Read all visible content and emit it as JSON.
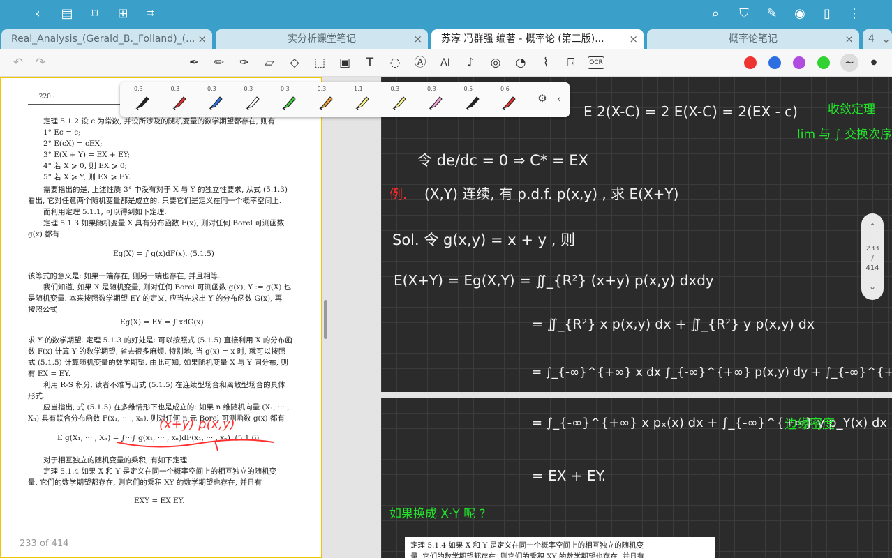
{
  "tabs": [
    {
      "label": "Real_Analysis_(Gerald_B._Folland)_(...",
      "close": "×"
    },
    {
      "label": "实分析课堂笔记",
      "close": "×"
    },
    {
      "label": "苏淳 冯群强 编著 - 概率论 (第三版)...",
      "close": "×"
    },
    {
      "label": "概率论笔记",
      "close": "×"
    },
    {
      "label": "4",
      "close": "⌄"
    }
  ],
  "colors": {
    "bar": "#3aa0c9",
    "highlight": "#f2c500",
    "note_bg": "#2b2b2b"
  },
  "pens": [
    {
      "width": "0.3",
      "color": "#222222"
    },
    {
      "width": "0.3",
      "color": "#e03030"
    },
    {
      "width": "0.3",
      "color": "#2d6fe0"
    },
    {
      "width": "0.3",
      "color": "#ffffff"
    },
    {
      "width": "0.3",
      "color": "#3ad13a"
    },
    {
      "width": "0.3",
      "color": "#f0a030"
    },
    {
      "width": "1.1",
      "color": "#f5f28a"
    },
    {
      "width": "0.3",
      "color": "#f5f28a"
    },
    {
      "width": "0.3",
      "color": "#f0a0d8"
    },
    {
      "width": "0.5",
      "color": "#222222"
    },
    {
      "width": "0.6",
      "color": "#e03030"
    }
  ],
  "swatches": [
    "#ee3333",
    "#2d6fe0",
    "#b04ce0",
    "#33d233"
  ],
  "pdf": {
    "page_header": "· 220 ·",
    "lines": [
      "定理 5.1.2   设 c 为常数, 并设所涉及的随机变量的数学期望都存在, 则有",
      "1°  Ec = c;",
      "2°  E(cX) = cEX;",
      "3°  E(X + Y) = EX + EY;",
      "4°  若 X ⩾ 0, 则 EX ⩾ 0;",
      "5°  若 X ⩾ Y, 则 EX ⩾ EY.",
      "需要指出的是, 上述性质 3° 中没有对于 X 与 Y 的独立性要求, 从式 (5.1.3)",
      "看出, 它对任意两个随机变量都是成立的, 只要它们是定义在同一个概率空间上.",
      "而利用定理 5.1.1, 可以得到如下定理.",
      "定理 5.1.3   如果随机变量 X 具有分布函数 F(x), 则对任何 Borel 可测函数",
      "g(x) 都有",
      "Eg(X) = ∫ g(x)dF(x).                                    (5.1.5)",
      "该等式的意义是: 如果一端存在, 则另一端也存在, 并且相等.",
      "我们知道, 如果 X 是随机变量, 则对任何 Borel 可测函数 g(x), Y := g(X) 也",
      "是随机变量. 本来按照数学期望 EY 的定义, 应当先求出 Y 的分布函数 G(x), 再",
      "按照公式",
      "Eg(X) = EY = ∫ xdG(x)",
      "求 Y 的数学期望. 定理 5.1.3 的好处是: 可以按照式 (5.1.5) 直接利用 X 的分布函",
      "数 F(x) 计算 Y 的数学期望, 省去很多麻烦. 特别地, 当 g(x) = x 时, 就可以按照",
      "式 (5.1.5) 计算随机变量的数学期望. 由此可知, 如果随机变量 X 与 Y 同分布, 则",
      "有 EX = EY.",
      "利用 R-S 积分, 读者不难写出式 (5.1.5) 在连续型场合和离散型场合的具体",
      "形式.",
      "应当指出, 式 (5.1.5) 在多维情形下也是成立的: 如果 n 维随机向量 (X₁, ··· ,",
      "Xₙ) 具有联合分布函数 F(x₁, ··· , xₙ), 则对任何 n 元 Borel 可测函数 g(x) 都有",
      "E g(X₁, ··· , Xₙ) = ∫···∫ g(x₁, ··· , xₙ)dF(x₁, ··· , xₙ).       (5.1.6)",
      "对于相互独立的随机变量的乘积, 有如下定理.",
      "定理 5.1.4   如果 X 和 Y 是定义在同一个概率空间上的相互独立的随机变",
      "量, 它们的数学期望都存在, 则它们的乘积 XY 的数学期望也存在, 并且有",
      "EXY = EX EY."
    ],
    "annotation": "(x+y)  p(x,y)",
    "footer": "233 of 414"
  },
  "note1": {
    "partial_top": "E 2(X-C) = 2 E(X-C) = 2(EX - c)",
    "green_1": "收敛定理",
    "green_2": "lim 与 ∫ 交换次序",
    "line_1": "令 de/dc = 0  ⇒  C* = EX",
    "red_label": "例.",
    "line_2": "(X,Y) 连续, 有 p.d.f.   p(x,y) ,  求 E(X+Y)",
    "line_3": "Sol. 令 g(x,y) = x + y ,   则",
    "line_4": "E(X+Y) = Eg(X,Y) = ∬_{R²} (x+y) p(x,y) dxdy",
    "line_5": "= ∬_{R²} x p(x,y) dx  +  ∬_{R²} y p(x,y) dx",
    "line_6": "= ∫_{-∞}^{+∞} x dx ∫_{-∞}^{+∞} p(x,y) dy + ∫_{-∞}^{+∞} y dy ∫_{-∞}^{+∞} p(x,y) dx"
  },
  "note2": {
    "line_1": "= ∫_{-∞}^{+∞} x pₓ(x) dx  +  ∫_{-∞}^{+∞} y p_Y(x) dx",
    "green_1": "边缘密度",
    "line_2": "= EX + EY.",
    "green_2": "如果换成 X·Y 呢 ?",
    "pasted": "定理 5.1.4   如果 X 和 Y 是定义在同一个概率空间上的相互独立的随机变",
    "pasted_2": "量, 它们的数学期望都存在, 则它们的乘积 XY 的数学期望也存在, 并且有"
  },
  "pager": {
    "current": "233",
    "sep": "/",
    "total": "414"
  }
}
